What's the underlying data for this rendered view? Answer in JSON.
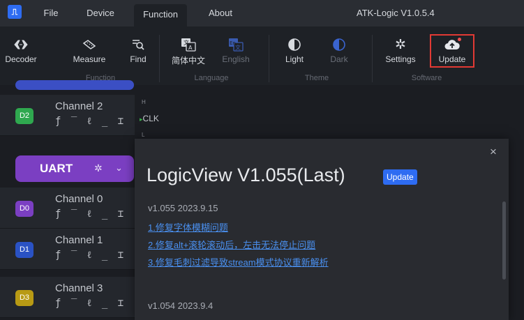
{
  "menubar": {
    "logo": "⎍",
    "items": [
      "File",
      "Device",
      "Function",
      "About"
    ],
    "active": "Function",
    "app_title": "ATK-Logic  V1.0.5.4"
  },
  "ribbon": {
    "buttons": [
      {
        "label": "Decoder",
        "icon": "decoder-icon"
      },
      {
        "label": "Measure",
        "icon": "measure-icon"
      },
      {
        "label": "Find",
        "icon": "find-icon"
      },
      {
        "label": "简体中文",
        "icon": "language-zh-icon"
      },
      {
        "label": "English",
        "icon": "language-en-icon"
      },
      {
        "label": "Light",
        "icon": "light-theme-icon"
      },
      {
        "label": "Dark",
        "icon": "dark-theme-icon"
      },
      {
        "label": "Settings",
        "icon": "gear-icon"
      },
      {
        "label": "Update",
        "icon": "cloud-upload-icon"
      }
    ],
    "groups": [
      "Function",
      "Language",
      "Theme",
      "Software"
    ]
  },
  "channels": [
    {
      "badge": "D2",
      "name": "Channel 2",
      "color": "#2fa84f"
    },
    {
      "badge": "D0",
      "name": "Channel 0",
      "color": "#7b3fc2"
    },
    {
      "badge": "D1",
      "name": "Channel 1",
      "color": "#2a52c4"
    },
    {
      "badge": "D3",
      "name": "Channel 3",
      "color": "#b89a14"
    }
  ],
  "trigger_tools": "ƒ ‾ ℓ _ ⌶",
  "uart": {
    "label": "UART"
  },
  "signal": {
    "high": "H",
    "low": "L",
    "name": "CLK"
  },
  "dialog": {
    "close": "×",
    "title": "LogicView V1.055(Last)",
    "badge": "Update",
    "versions": [
      {
        "header": "v1.055  2023.9.15",
        "notes": [
          "1.修复字体模糊问题",
          "2.修复alt+滚轮滚动后，左击无法停止问题",
          "3.修复毛刺过滤导致stream模式协议重新解析"
        ]
      },
      {
        "header": "v1.054  2023.9.4",
        "notes": []
      }
    ]
  },
  "colors": {
    "accent": "#2e6cf2",
    "uart": "#7b3fc2",
    "highlight": "#e23a34"
  }
}
